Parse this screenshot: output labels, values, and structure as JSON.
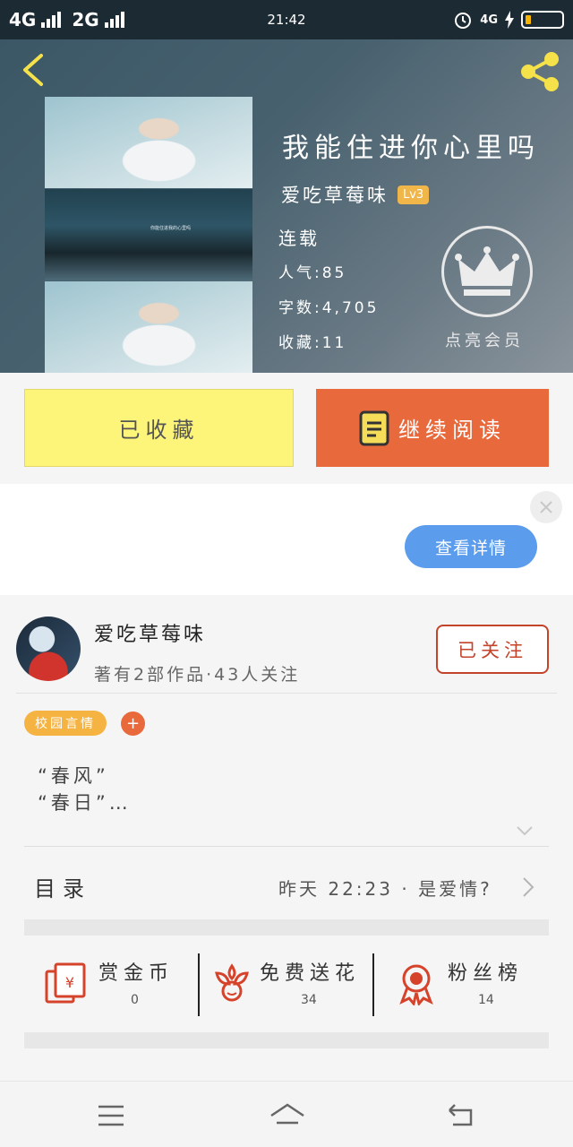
{
  "status_bar": {
    "signal_1": "4G",
    "signal_2": "2G",
    "time": "21:42",
    "network": "4G"
  },
  "book": {
    "title": "我能住进你心里吗",
    "author": "爱吃草莓味",
    "level": "Lv3",
    "status": "连载",
    "popularity": "人气:85",
    "word_count": "字数:4,705",
    "favorites": "收藏:11",
    "vip_label": "点亮会员",
    "cover_caption": "你能住进我的心里吗"
  },
  "actions": {
    "collected": "已收藏",
    "continue_reading": "继续阅读"
  },
  "ad": {
    "details_button": "查看详情"
  },
  "author_card": {
    "name": "爱吃草莓味",
    "works_info": "著有2部作品·43人关注",
    "follow_button": "已关注"
  },
  "tags": [
    "校园言情"
  ],
  "tag_add": "+",
  "summary": {
    "line1": "“春风”",
    "line2": "“春日”…"
  },
  "toc": {
    "label": "目录",
    "latest": "昨天 22:23 · 是爱情?"
  },
  "stats": [
    {
      "label": "赏金币",
      "value": "0",
      "icon": "red-envelope-icon"
    },
    {
      "label": "免费送花",
      "value": "34",
      "icon": "flower-icon"
    },
    {
      "label": "粉丝榜",
      "value": "14",
      "icon": "medal-icon"
    }
  ],
  "colors": {
    "accent_orange": "#e8693c",
    "collected_yellow": "#fdf47a",
    "follow_red": "#c4432b",
    "details_blue": "#5b9cec",
    "level_badge": "#f0b64a"
  }
}
